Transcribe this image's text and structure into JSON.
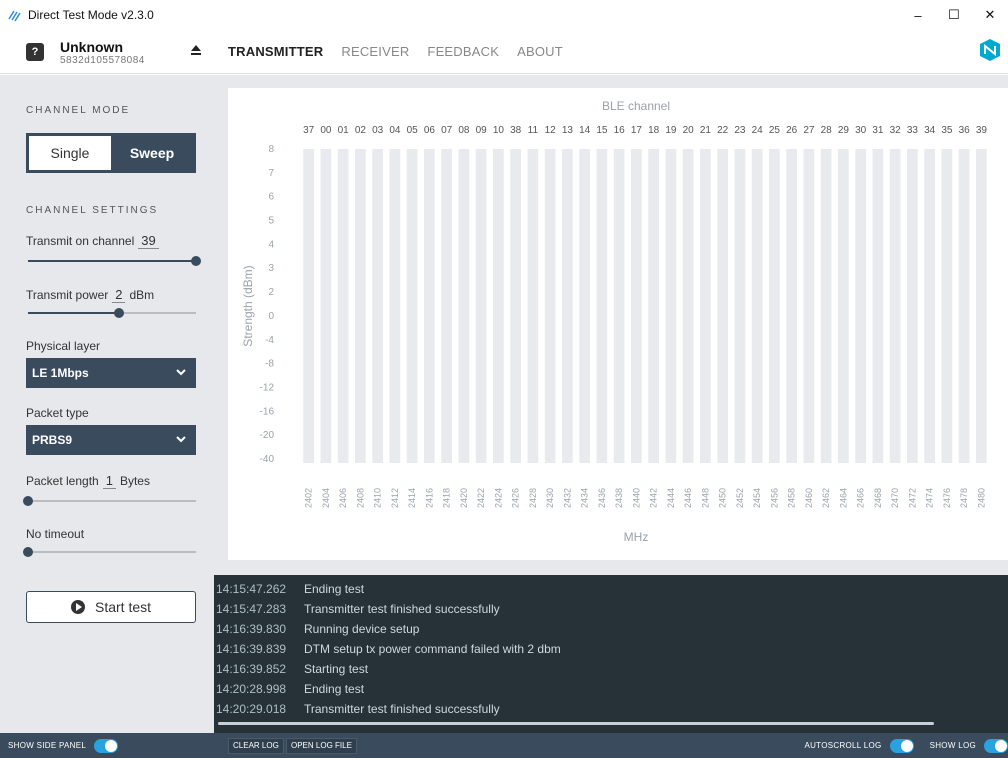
{
  "window": {
    "title": "Direct Test Mode v2.3.0",
    "controls": [
      "–",
      "☐",
      "✕"
    ]
  },
  "device": {
    "name": "Unknown",
    "serial": "5832d105578084"
  },
  "nav": {
    "tabs": [
      {
        "label": "TRANSMITTER",
        "active": true
      },
      {
        "label": "RECEIVER",
        "active": false
      },
      {
        "label": "FEEDBACK",
        "active": false
      },
      {
        "label": "ABOUT",
        "active": false
      }
    ]
  },
  "sidebar": {
    "channel_mode_title": "CHANNEL MODE",
    "mode_single": "Single",
    "mode_sweep": "Sweep",
    "channel_settings_title": "CHANNEL SETTINGS",
    "transmit_channel_label": "Transmit on channel",
    "transmit_channel_value": "39",
    "transmit_channel_level": 1.0,
    "transmit_power_label": "Transmit power",
    "transmit_power_value": "2",
    "transmit_power_unit": "dBm",
    "transmit_power_level": 0.54,
    "physical_layer_label": "Physical layer",
    "physical_layer_value": "LE 1Mbps",
    "packet_type_label": "Packet type",
    "packet_type_value": "PRBS9",
    "packet_length_label": "Packet length",
    "packet_length_value": "1",
    "packet_length_unit": "Bytes",
    "packet_length_level": 0.0,
    "timeout_label": "No timeout",
    "timeout_level": 0.0,
    "start_label": "Start test"
  },
  "chart_data": {
    "type": "bar",
    "title": "BLE channel",
    "xlabel": "MHz",
    "ylabel": "Strength (dBm)",
    "channels": [
      "37",
      "00",
      "01",
      "02",
      "03",
      "04",
      "05",
      "06",
      "07",
      "08",
      "09",
      "10",
      "38",
      "11",
      "12",
      "13",
      "14",
      "15",
      "16",
      "17",
      "18",
      "19",
      "20",
      "21",
      "22",
      "23",
      "24",
      "25",
      "26",
      "27",
      "28",
      "29",
      "30",
      "31",
      "32",
      "33",
      "34",
      "35",
      "36",
      "39"
    ],
    "frequencies": [
      "2402",
      "2404",
      "2406",
      "2408",
      "2410",
      "2412",
      "2414",
      "2416",
      "2418",
      "2420",
      "2422",
      "2424",
      "2426",
      "2428",
      "2430",
      "2432",
      "2434",
      "2436",
      "2438",
      "2440",
      "2442",
      "2444",
      "2446",
      "2448",
      "2450",
      "2452",
      "2454",
      "2456",
      "2458",
      "2460",
      "2462",
      "2464",
      "2466",
      "2468",
      "2470",
      "2472",
      "2474",
      "2476",
      "2478",
      "2480"
    ],
    "y_ticks": [
      "8",
      "7",
      "6",
      "5",
      "4",
      "3",
      "2",
      "0",
      "-4",
      "-8",
      "-12",
      "-16",
      "-20",
      "-40"
    ],
    "bar_color": "#e8eaed",
    "text_color": "#9aa3ab"
  },
  "log": {
    "entries": [
      {
        "time": "14:15:47.262",
        "msg": "Ending test"
      },
      {
        "time": "14:15:47.283",
        "msg": "Transmitter test finished successfully"
      },
      {
        "time": "14:16:39.830",
        "msg": "Running device setup"
      },
      {
        "time": "14:16:39.839",
        "msg": "DTM setup tx power command failed with 2 dbm"
      },
      {
        "time": "14:16:39.852",
        "msg": "Starting test"
      },
      {
        "time": "14:20:28.998",
        "msg": "Ending test"
      },
      {
        "time": "14:20:29.018",
        "msg": "Transmitter test finished successfully"
      }
    ]
  },
  "bottombar": {
    "show_side_panel": "SHOW SIDE PANEL",
    "clear_log": "CLEAR LOG",
    "open_log_file": "OPEN LOG FILE",
    "autoscroll_log": "AUTOSCROLL LOG",
    "show_log": "SHOW LOG"
  },
  "colors": {
    "accent": "#2aa2e0",
    "dark": "#394b5d",
    "log_bg": "#263238"
  }
}
